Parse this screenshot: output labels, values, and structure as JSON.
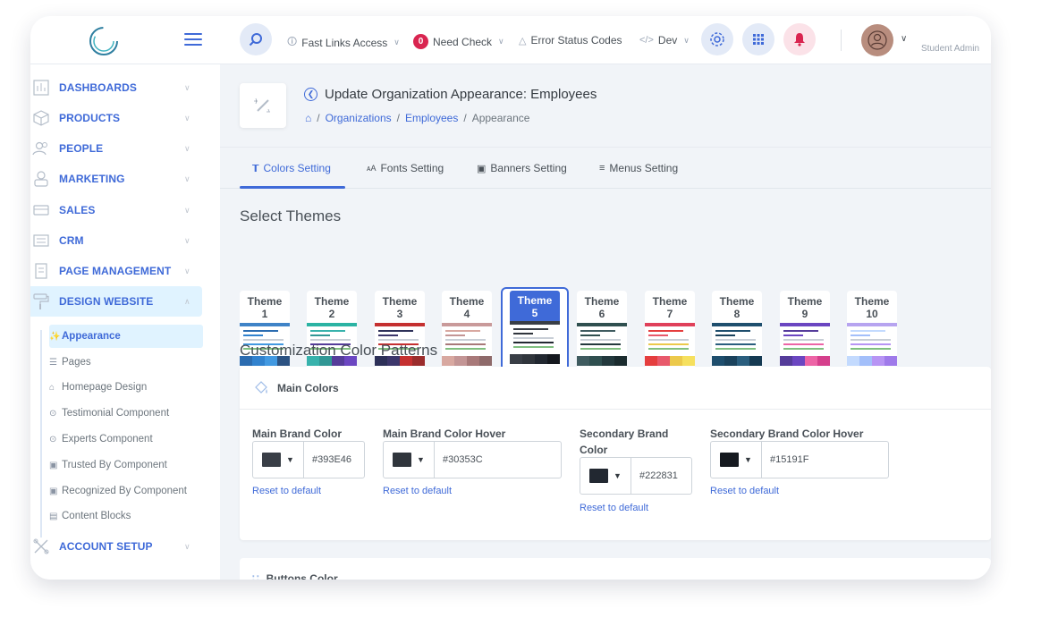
{
  "topbar": {
    "fast_links": "Fast Links Access",
    "need_check_count": "0",
    "need_check": "Need Check",
    "error_codes": "Error Status Codes",
    "dev": "Dev",
    "user_name": "Student Admin"
  },
  "sidebar": {
    "items": [
      {
        "label": "DASHBOARDS",
        "icon": "dashboard-icon"
      },
      {
        "label": "PRODUCTS",
        "icon": "cube-icon"
      },
      {
        "label": "PEOPLE",
        "icon": "people-icon"
      },
      {
        "label": "MARKETING",
        "icon": "marketing-icon"
      },
      {
        "label": "SALES",
        "icon": "sales-icon"
      },
      {
        "label": "CRM",
        "icon": "crm-icon"
      },
      {
        "label": "PAGE MANAGEMENT",
        "icon": "page-icon"
      },
      {
        "label": "DESIGN WEBSITE",
        "icon": "paint-roller-icon"
      },
      {
        "label": "ACCOUNT SETUP",
        "icon": "tools-icon"
      }
    ],
    "sub_items": [
      {
        "label": "Appearance",
        "icon": "magic-wand-icon"
      },
      {
        "label": "Pages",
        "icon": "list-icon"
      },
      {
        "label": "Homepage Design",
        "icon": "home-icon"
      },
      {
        "label": "Testimonial Component",
        "icon": "quote-icon"
      },
      {
        "label": "Experts Component",
        "icon": "expert-icon"
      },
      {
        "label": "Trusted By Component",
        "icon": "trusted-icon"
      },
      {
        "label": "Recognized By Component",
        "icon": "award-icon"
      },
      {
        "label": "Content Blocks",
        "icon": "blocks-icon"
      }
    ]
  },
  "header": {
    "title": "Update Organization Appearance: Employees",
    "breadcrumb": [
      "Organizations",
      "Employees",
      "Appearance"
    ]
  },
  "tabs": [
    "Colors Setting",
    "Fonts Setting",
    "Banners Setting",
    "Menus Setting"
  ],
  "themes_title": "Select Themes",
  "themes": [
    {
      "line1": "Theme",
      "line2": "1",
      "bar": "#3f83c7",
      "strip": [
        "#2b6cb0",
        "#3182ce",
        "#4299e1",
        "#2c5282"
      ]
    },
    {
      "line1": "Theme",
      "line2": "2",
      "bar": "#2bb3a3",
      "strip": [
        "#38b2ac",
        "#319795",
        "#553c9a",
        "#6b46c1"
      ]
    },
    {
      "line1": "Theme",
      "line2": "3",
      "bar": "#c53030",
      "strip": [
        "#2d3058",
        "#3c366b",
        "#c53030",
        "#9b2c2c"
      ]
    },
    {
      "line1": "Theme",
      "line2": "4",
      "bar": "#c99a9a",
      "strip": [
        "#d8a8a0",
        "#c39595",
        "#a87979",
        "#8e6a6a"
      ]
    },
    {
      "line1": "Theme",
      "line2": "5",
      "bar": "#393E46",
      "strip": [
        "#393E46",
        "#30353C",
        "#222831",
        "#15191F"
      ]
    },
    {
      "line1": "Theme",
      "line2": "6",
      "bar": "#2f4f4f",
      "strip": [
        "#3f5b5f",
        "#2f4f4f",
        "#23393d",
        "#1a2b2e"
      ]
    },
    {
      "line1": "Theme",
      "line2": "7",
      "bar": "#e0405a",
      "strip": [
        "#e53e3e",
        "#e8596b",
        "#ecc94b",
        "#f6e05e"
      ]
    },
    {
      "line1": "Theme",
      "line2": "8",
      "bar": "#1f4f6e",
      "strip": [
        "#1e4e6d",
        "#1a425c",
        "#2a5e7e",
        "#153a52"
      ]
    },
    {
      "line1": "Theme",
      "line2": "9",
      "bar": "#6b46c1",
      "strip": [
        "#553c9a",
        "#6b46c1",
        "#ed64a6",
        "#d53f8c"
      ]
    },
    {
      "line1": "Theme",
      "line2": "10",
      "bar": "#b7a4f0",
      "strip": [
        "#c3dafe",
        "#a3bffa",
        "#b794f4",
        "#9f7aea"
      ]
    }
  ],
  "custom_title": "Customization Color Patterns",
  "main_colors": {
    "title": "Main Colors",
    "fields": [
      {
        "label": "Main Brand Color",
        "value": "#393E46",
        "reset": "Reset to default"
      },
      {
        "label": "Main Brand Color Hover",
        "value": "#30353C",
        "reset": "Reset to default"
      },
      {
        "label": "Secondary Brand Color",
        "value": "#222831",
        "reset": "Reset to default"
      },
      {
        "label": "Secondary Brand Color Hover",
        "value": "#15191F",
        "reset": "Reset to default"
      }
    ]
  },
  "buttons_color": {
    "title": "Buttons Color"
  }
}
